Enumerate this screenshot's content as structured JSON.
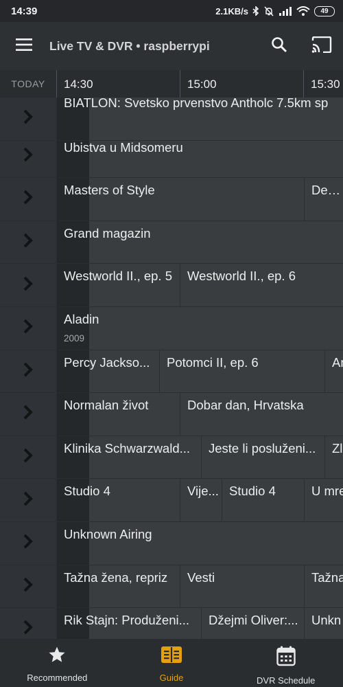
{
  "status_bar": {
    "time": "14:39",
    "net_speed": "2.1KB/s",
    "battery": "49",
    "icons": [
      "bluetooth-icon",
      "bell-off-icon",
      "signal-icon",
      "wifi-icon",
      "battery-icon"
    ]
  },
  "app_bar": {
    "title": "Live TV & DVR • raspberrypi",
    "icons": [
      "menu-icon",
      "search-icon",
      "cast-icon"
    ]
  },
  "time_header": {
    "today": "TODAY",
    "slots": [
      "14:30",
      "15:00",
      "15:30"
    ]
  },
  "colors": {
    "accent": "#e5a00d",
    "background": "#3a3d40",
    "channel_column": "#2f3236",
    "app_bar": "#2e3134"
  },
  "guide": {
    "rows": [
      {
        "programs": [
          {
            "title": "BIATLON: Svetsko prvenstvo Antholc 7.5km sp"
          }
        ]
      },
      {
        "programs": [
          {
            "title": "Ubistva u Midsomeru"
          }
        ]
      },
      {
        "programs": [
          {
            "title": "Masters of Style"
          },
          {
            "title": "Design"
          }
        ]
      },
      {
        "programs": [
          {
            "title": "Grand magazin"
          }
        ]
      },
      {
        "programs": [
          {
            "title": "Westworld II., ep. 5"
          },
          {
            "title": "Westworld II., ep. 6"
          }
        ]
      },
      {
        "programs": [
          {
            "title": "Aladin",
            "subtitle": "2009"
          }
        ]
      },
      {
        "programs": [
          {
            "title": "Percy Jackso..."
          },
          {
            "title": "Potomci II, ep. 6"
          },
          {
            "title": "An"
          }
        ]
      },
      {
        "programs": [
          {
            "title": "Normalan život"
          },
          {
            "title": "Dobar dan, Hrvatska"
          }
        ]
      },
      {
        "programs": [
          {
            "title": "Klinika Schwarzwald..."
          },
          {
            "title": "Jeste li posluženi..."
          },
          {
            "title": "Zl"
          }
        ]
      },
      {
        "programs": [
          {
            "title": "Studio 4"
          },
          {
            "title": "Vije..."
          },
          {
            "title": "Studio 4"
          },
          {
            "title": "U mre"
          }
        ]
      },
      {
        "programs": [
          {
            "title": "Unknown Airing"
          }
        ]
      },
      {
        "programs": [
          {
            "title": "Tažna žena, repriz"
          },
          {
            "title": "Vesti"
          },
          {
            "title": "Tažna"
          }
        ]
      },
      {
        "programs": [
          {
            "title": "Rik Stajn: Produženi..."
          },
          {
            "title": "Džejmi Oliver:..."
          },
          {
            "title": "Unkn"
          }
        ]
      }
    ]
  },
  "bottom_nav": {
    "items": [
      {
        "label": "Recommended",
        "icon": "star-icon",
        "active": false
      },
      {
        "label": "Guide",
        "icon": "guide-book-icon",
        "active": true
      },
      {
        "label": "DVR Schedule",
        "icon": "calendar-icon",
        "active": false
      }
    ]
  }
}
